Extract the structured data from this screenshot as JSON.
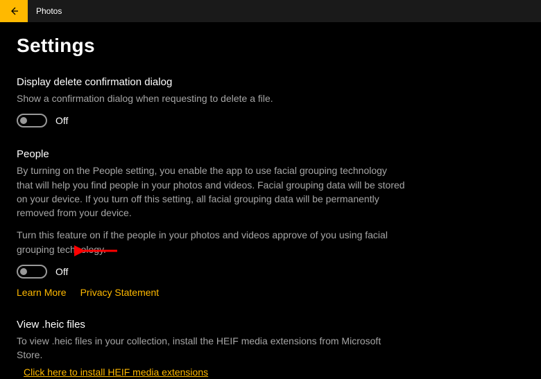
{
  "app": {
    "title": "Photos"
  },
  "page": {
    "title": "Settings"
  },
  "sections": {
    "delete_confirm": {
      "title": "Display delete confirmation dialog",
      "desc": "Show a confirmation dialog when requesting to delete a file.",
      "toggle_state": "Off"
    },
    "people": {
      "title": "People",
      "desc1": "By turning on the People setting, you enable the app to use facial grouping technology that will help you find people in your photos and videos. Facial grouping data will be stored on your device. If you turn off this setting, all facial grouping data will be permanently removed from your device.",
      "desc2": "Turn this feature on if the people in your photos and videos approve of you using facial grouping technology.",
      "toggle_state": "Off",
      "learn_more": "Learn More",
      "privacy": "Privacy Statement"
    },
    "heic": {
      "title": "View .heic files",
      "desc": "To view .heic files in your collection, install the HEIF media extensions from Microsoft Store.",
      "link": "Click here to install HEIF media extensions"
    }
  }
}
